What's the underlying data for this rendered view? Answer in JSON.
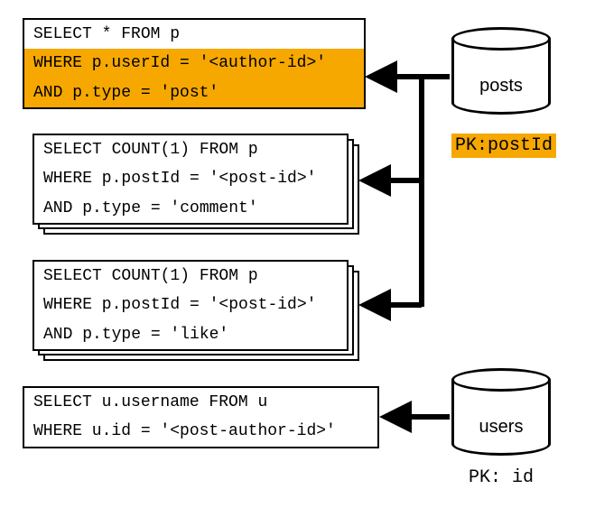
{
  "queries": [
    {
      "lines": [
        {
          "text": "SELECT * FROM p",
          "highlight": false
        },
        {
          "text": "WHERE p.userId = '<author-id>'",
          "highlight": true
        },
        {
          "text": "AND p.type = 'post'",
          "highlight": true
        }
      ],
      "stacked": false
    },
    {
      "lines": [
        {
          "text": "SELECT COUNT(1) FROM p",
          "highlight": false
        },
        {
          "text": "WHERE p.postId = '<post-id>'",
          "highlight": false
        },
        {
          "text": "AND p.type = 'comment'",
          "highlight": false
        }
      ],
      "stacked": true
    },
    {
      "lines": [
        {
          "text": "SELECT COUNT(1) FROM p",
          "highlight": false
        },
        {
          "text": "WHERE p.postId = '<post-id>'",
          "highlight": false
        },
        {
          "text": "AND p.type = 'like'",
          "highlight": false
        }
      ],
      "stacked": true
    },
    {
      "lines": [
        {
          "text": "SELECT u.username FROM u",
          "highlight": false
        },
        {
          "text": "WHERE u.id = '<post-author-id>'",
          "highlight": false
        }
      ],
      "stacked": false
    }
  ],
  "databases": [
    {
      "label": "posts",
      "pk": "PK:postId",
      "pk_highlight": true
    },
    {
      "label": "users",
      "pk": "PK: id",
      "pk_highlight": false
    }
  ]
}
